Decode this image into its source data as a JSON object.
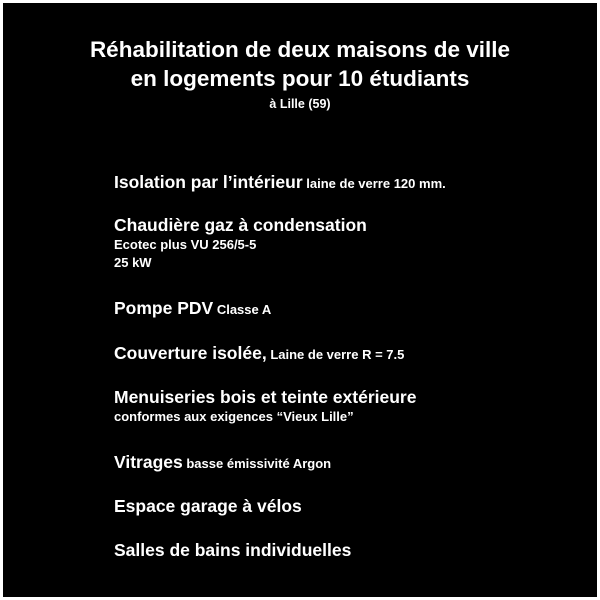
{
  "header": {
    "title_line1": "Réhabilitation de deux maisons de ville",
    "title_line2": "en logements pour 10 étudiants",
    "location": "à Lille (59)"
  },
  "features": [
    {
      "main": "Isolation par l’intérieur",
      "detail": " laine de verre 120 mm."
    },
    {
      "main": "Chaudière gaz à condensation",
      "line2": "Ecotec plus VU 256/5-5",
      "line3": "25 kW"
    },
    {
      "main": "Pompe PDV",
      "detail": " Classe A"
    },
    {
      "main": "Couverture isolée,",
      "detail": " Laine de verre R = 7.5"
    },
    {
      "main": "Menuiseries bois et teinte extérieure",
      "line2": "conformes aux exigences “Vieux Lille”"
    },
    {
      "main": "Vitrages",
      "detail": " basse émissivité Argon"
    },
    {
      "main": "Espace garage à vélos"
    },
    {
      "main": "Salles de bains individuelles"
    }
  ],
  "colors": {
    "background": "#000000",
    "text": "#ffffff",
    "border": "#ffffff"
  }
}
